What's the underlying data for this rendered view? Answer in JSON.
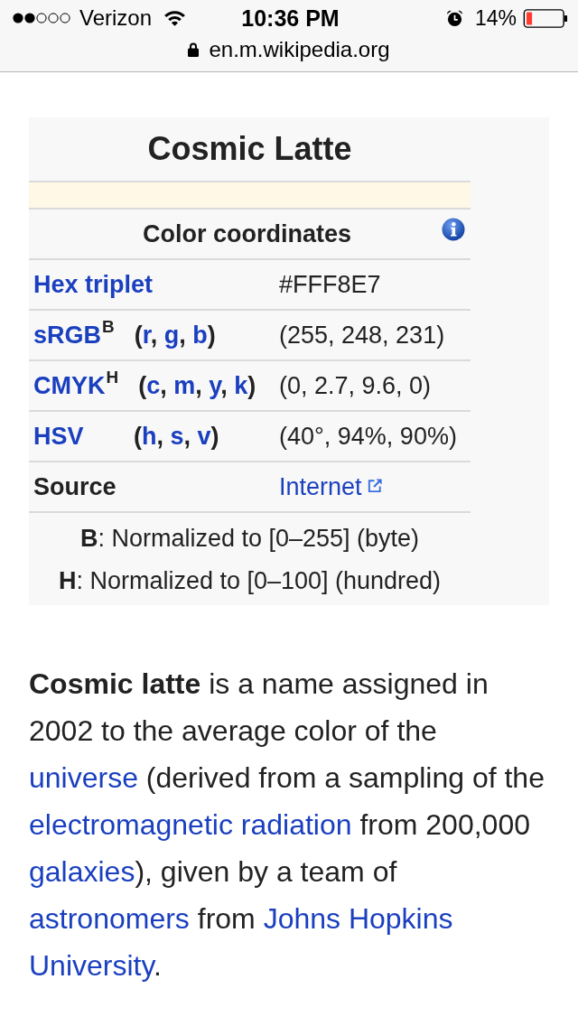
{
  "status_bar": {
    "carrier": "Verizon",
    "time": "10:36 PM",
    "battery": "14%"
  },
  "address_bar": {
    "url": "en.m.wikipedia.org"
  },
  "infobox": {
    "title": "Cosmic Latte",
    "swatch": {
      "color": "#fff8e7"
    },
    "section_header": "Color coordinates",
    "rows": [
      {
        "label": "Hex triplet",
        "label_link": true,
        "value": "#FFF8E7",
        "value_link": false
      },
      {
        "label": "sRGB$^{B}$",
        "label_link": true,
        "params": [
          {
            "kind": "plain",
            "text": "("
          },
          {
            "kind": "link",
            "text": "r"
          },
          {
            "kind": "plain",
            "text": ", "
          },
          {
            "kind": "link",
            "text": "g"
          },
          {
            "kind": "plain",
            "text": ", "
          },
          {
            "kind": "link",
            "text": "b"
          },
          {
            "kind": "plain",
            "text": ")"
          }
        ],
        "value": "(255, 248, 231)",
        "value_link": false
      },
      {
        "label": "CMYK$^{H}$",
        "label_link": true,
        "params": [
          {
            "kind": "plain",
            "text": "("
          },
          {
            "kind": "link",
            "text": "c"
          },
          {
            "kind": "plain",
            "text": ", "
          },
          {
            "kind": "link",
            "text": "m"
          },
          {
            "kind": "plain",
            "text": ", "
          },
          {
            "kind": "link",
            "text": "y"
          },
          {
            "kind": "plain",
            "text": ", "
          },
          {
            "kind": "link",
            "text": "k"
          },
          {
            "kind": "plain",
            "text": ")"
          }
        ],
        "value": "(0, 2.7, 9.6, 0)",
        "value_link": false
      },
      {
        "label": "HSV",
        "label_link": true,
        "params": [
          {
            "kind": "plain",
            "text": "("
          },
          {
            "kind": "link",
            "text": "h"
          },
          {
            "kind": "plain",
            "text": ", "
          },
          {
            "kind": "link",
            "text": "s"
          },
          {
            "kind": "plain",
            "text": ", "
          },
          {
            "kind": "link",
            "text": "v"
          },
          {
            "kind": "plain",
            "text": ")"
          }
        ],
        "value": "(40°, 94%, 90%)",
        "value_link": false
      },
      {
        "label": "Source",
        "label_link": false,
        "value": "Internet",
        "value_link": true
      }
    ],
    "footnotes": [
      "**B**: Normalized to [0–255] (byte)",
      "**H**: Normalized to [0–100] (hundred)"
    ]
  },
  "article": {
    "paragraph": [
      {
        "kind": "bold",
        "text": "Cosmic latte"
      },
      {
        "kind": "plain",
        "text": " is a name assigned in 2002 to the average color of the "
      },
      {
        "kind": "link",
        "text": "universe"
      },
      {
        "kind": "plain",
        "text": " (derived from a sampling of the "
      },
      {
        "kind": "link",
        "text": "electromagnetic radiation"
      },
      {
        "kind": "plain",
        "text": " from 200,000 "
      },
      {
        "kind": "link",
        "text": "galaxies"
      },
      {
        "kind": "plain",
        "text": "), given by a team of "
      },
      {
        "kind": "link",
        "text": "astronomers"
      },
      {
        "kind": "plain",
        "text": " from "
      },
      {
        "kind": "link",
        "text": "Johns Hopkins"
      },
      {
        "kind": "link",
        "text": "University"
      },
      {
        "kind": "plain",
        "text": "."
      }
    ]
  }
}
